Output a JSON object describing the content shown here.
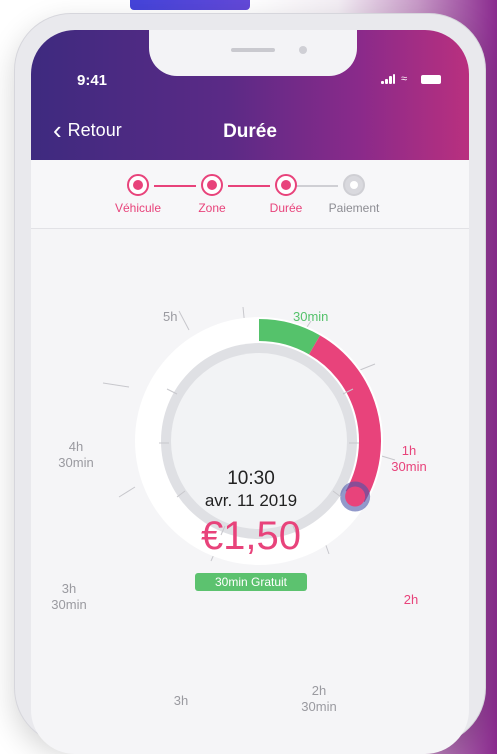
{
  "status_bar": {
    "time": "9:41"
  },
  "header": {
    "back_label": "Retour",
    "title": "Durée"
  },
  "stepper": {
    "steps": [
      {
        "label": "Véhicule",
        "state": "active",
        "icon": "car-icon"
      },
      {
        "label": "Zone",
        "state": "active",
        "icon": "location-pin-icon"
      },
      {
        "label": "Durée",
        "state": "active",
        "icon": "clock-icon"
      },
      {
        "label": "Paiement",
        "state": "inactive",
        "icon": "coins-icon"
      }
    ]
  },
  "dial": {
    "labels": {
      "l30min": "30min",
      "l1h": "1h",
      "l1h30_line2": "30min",
      "l2h": "2h",
      "l2h30_line1": "2h",
      "l2h30_line2": "30min",
      "l3h": "3h",
      "l3h30_line1": "3h",
      "l3h30_line2": "30min",
      "l4h30_line1": "4h",
      "l4h30_line2": "30min",
      "l5h": "5h"
    },
    "selected_duration_hours": 2,
    "free_duration_hours": 0.5,
    "max_hours": 6
  },
  "summary": {
    "time": "10:30",
    "date": "avr. 11 2019",
    "price": "€1,50",
    "free_badge": "30min Gratuit"
  },
  "colors": {
    "accent": "#e8437b",
    "free": "#55c26b",
    "header_start": "#3e2a7f",
    "header_end": "#b9307f",
    "handle": "#4a55a8"
  }
}
